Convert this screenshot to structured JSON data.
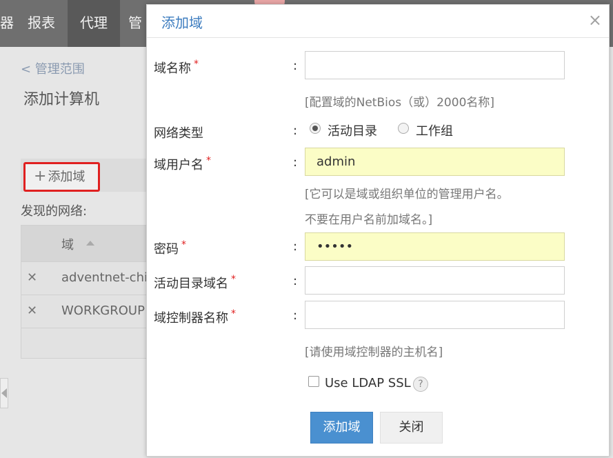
{
  "topnav": {
    "items": [
      {
        "label": "器"
      },
      {
        "label": "报表"
      },
      {
        "label": "代理"
      },
      {
        "label": "管"
      }
    ]
  },
  "background": {
    "breadcrumb": "< 管理范围",
    "page_title": "添加计算机",
    "add_domain_label": "添加域",
    "found_networks_label": "发现的网络:",
    "table": {
      "column_header": "域",
      "rows": [
        {
          "value": "adventnet-chin"
        },
        {
          "value": "WORKGROUP"
        }
      ]
    }
  },
  "dialog": {
    "title": "添加域",
    "close": "×",
    "colon": ":",
    "domain_name_label": "域名称",
    "domain_name_value": "",
    "domain_name_hint": "[配置域的NetBios（或）2000名称]",
    "network_type_label": "网络类型",
    "network_type_options": [
      {
        "label": "活动目录",
        "checked": true
      },
      {
        "label": "工作组",
        "checked": false
      }
    ],
    "domain_user_label": "域用户名",
    "domain_user_value": "admin",
    "domain_user_hint_1": "[它可以是域或组织单位的管理用户名。",
    "domain_user_hint_2": "不要在用户名前加域名。]",
    "password_label": "密码",
    "password_value": "•••••",
    "ad_domain_label": "活动目录域名",
    "ad_domain_value": "",
    "dc_name_label": "域控制器名称",
    "dc_name_value": "",
    "dc_name_hint": "[请使用域控制器的主机名]",
    "ldap_ssl_label": "Use LDAP SSL",
    "ldap_ssl_checked": false,
    "help": "?",
    "required_mark": "*",
    "submit_label": "添加域",
    "close_label": "关闭"
  },
  "colors": {
    "accent": "#4a90d0",
    "title": "#3c7cbf",
    "required": "#e02020",
    "autofill": "#fbfdc6",
    "highlight_border": "#e02020"
  }
}
